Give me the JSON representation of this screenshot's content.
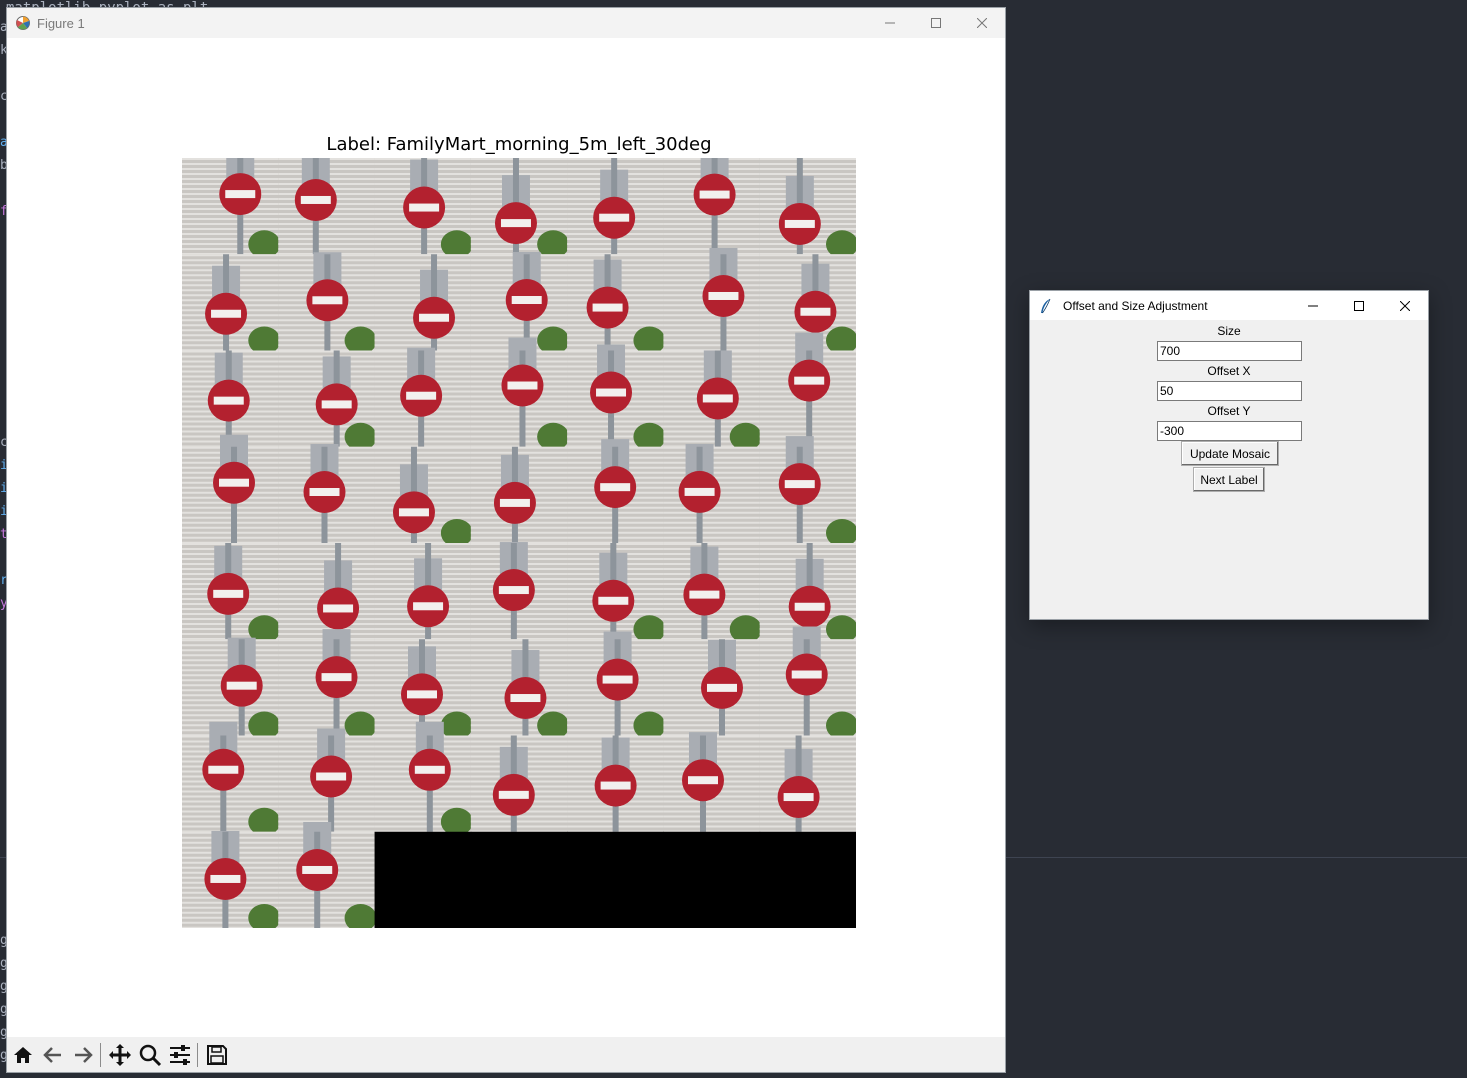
{
  "editor": {
    "top_text": "matplotlib.pyplot as plt",
    "fragments": [
      {
        "text": "a",
        "color": "#abb2bf"
      },
      {
        "text": "k",
        "color": "#abb2bf"
      },
      {
        "text": "c",
        "color": "#abb2bf"
      },
      {
        "text": "a",
        "color": "#61afef"
      },
      {
        "text": "b",
        "color": "#abb2bf"
      },
      {
        "text": "f",
        "color": "#c678dd"
      },
      {
        "text": "c",
        "color": "#abb2bf"
      },
      {
        "text": "i",
        "color": "#61afef"
      },
      {
        "text": "i",
        "color": "#61afef"
      },
      {
        "text": "i",
        "color": "#61afef"
      },
      {
        "text": "t",
        "color": "#c678dd"
      },
      {
        "text": "r",
        "color": "#61afef"
      },
      {
        "text": "y",
        "color": "#c678dd"
      },
      {
        "text": "g",
        "color": "#abb2bf"
      },
      {
        "text": "g",
        "color": "#abb2bf"
      },
      {
        "text": "g",
        "color": "#abb2bf"
      },
      {
        "text": "g",
        "color": "#abb2bf"
      },
      {
        "text": "g",
        "color": "#abb2bf"
      },
      {
        "text": "g",
        "color": "#abb2bf"
      }
    ]
  },
  "figure_window": {
    "title": "Figure 1",
    "plot_title": "Label: FamilyMart_morning_5m_left_30deg",
    "mosaic": {
      "columns": 7,
      "rows": 8,
      "filled_tiles": 51,
      "image_subject": "no-entry road sign",
      "sign_color": "#b3212f",
      "empty_color": "#000000"
    },
    "toolbar": [
      "home-icon",
      "back-icon",
      "forward-icon",
      "pan-icon",
      "zoom-icon",
      "configure-subplots-icon",
      "save-icon"
    ]
  },
  "dialog": {
    "title": "Offset and Size Adjustment",
    "size_label": "Size",
    "size_value": "700",
    "offset_x_label": "Offset X",
    "offset_x_value": "50",
    "offset_y_label": "Offset Y",
    "offset_y_value": "-300",
    "update_button": "Update Mosaic",
    "next_button": "Next Label"
  }
}
